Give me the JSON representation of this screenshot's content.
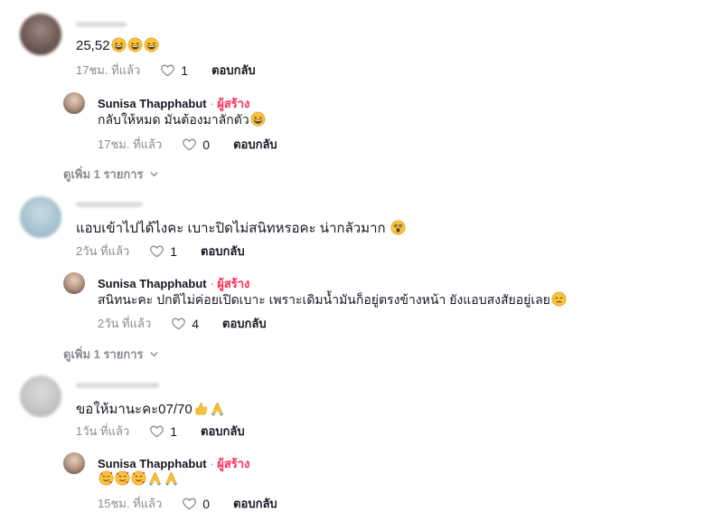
{
  "comments": [
    {
      "text": "25,52",
      "emojis": [
        "laughing-face",
        "laughing-face",
        "laughing-face"
      ],
      "time": "17ชม. ที่แล้ว",
      "likes": "1",
      "reply_label": "ตอบกลับ",
      "reply": {
        "author": "Sunisa Thapphabut",
        "separator": "·",
        "creator_badge": "ผู้สร้าง",
        "text": "กลับให้หมด มันต้องมาลักตัว",
        "emojis": [
          "laughing-face"
        ],
        "time": "17ชม. ที่แล้ว",
        "likes": "0",
        "reply_label": "ตอบกลับ"
      },
      "view_more": "ดูเพิ่ม 1 รายการ"
    },
    {
      "text": "แอบเข้าไปได้ไงคะ เบาะปิดไม่สนิทหรอคะ น่ากลัวมาก",
      "emojis": [
        "shocked-face"
      ],
      "time": "2วัน ที่แล้ว",
      "likes": "1",
      "reply_label": "ตอบกลับ",
      "reply": {
        "author": "Sunisa Thapphabut",
        "separator": "·",
        "creator_badge": "ผู้สร้าง",
        "text": "สนิทนะคะ ปกติไม่ค่อยเปิดเบาะ เพราะเดิมน้ำมันก็อยู่ตรงข้างหน้า ยังแอบสงสัยอยู่เลย",
        "emojis": [
          "sad-face"
        ],
        "time": "2วัน ที่แล้ว",
        "likes": "4",
        "reply_label": "ตอบกลับ"
      },
      "view_more": "ดูเพิ่ม 1 รายการ"
    },
    {
      "text": "ขอให้มานะคะ07/70",
      "emojis": [
        "thumbs-up",
        "praying-hands"
      ],
      "time": "1วัน ที่แล้ว",
      "likes": "1",
      "reply_label": "ตอบกลับ",
      "reply": {
        "author": "Sunisa Thapphabut",
        "separator": "·",
        "creator_badge": "ผู้สร้าง",
        "text": "",
        "emojis": [
          "smiling-hearts-face",
          "smiling-hearts-face",
          "smiling-hearts-face",
          "praying-hands",
          "praying-hands"
        ],
        "time": "15ชม. ที่แล้ว",
        "likes": "0",
        "reply_label": "ตอบกลับ"
      }
    }
  ],
  "colors": {
    "creator": "#fe2c55",
    "meta_gray": "#8a8b91",
    "text": "#161823"
  }
}
